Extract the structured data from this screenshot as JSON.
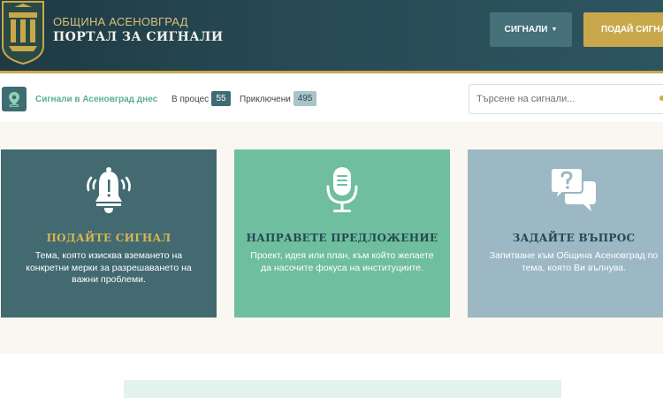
{
  "header": {
    "municipality": "ОБЩИНА АСЕНОВГРАД",
    "portal_title": "ПОРТАЛ ЗА СИГНАЛИ",
    "signals_button": "СИГНАЛИ",
    "submit_button": "ПОДАЙ СИГНАЛ",
    "colors": {
      "bg": "#1f3a44",
      "accent": "#c9a84c",
      "button": "#46707a"
    }
  },
  "status": {
    "title": "Сигнали в Асеновград днес",
    "in_progress_label": "В процес",
    "in_progress_count": "55",
    "completed_label": "Приключени",
    "completed_count": "495",
    "search_placeholder": "Търсене на сигнали..."
  },
  "cards": [
    {
      "icon": "bell-icon",
      "title": "ПОДАЙТЕ СИГНАЛ",
      "description": "Тема, която изисква вземането на конкретни мерки за разрешаването на важни проблеми.",
      "color": "#426a70"
    },
    {
      "icon": "microphone-icon",
      "title": "НАПРАВЕТЕ ПРЕДЛОЖЕНИЕ",
      "description": "Проект, идея или план, към който желаете да насочите фокуса на институциите.",
      "color": "#6fbea0"
    },
    {
      "icon": "question-chat-icon",
      "title": "ЗАДАЙТЕ ВЪПРОС",
      "description": "Запитване към Община Асеновград по тема, която Ви вълнува.",
      "color": "#9bb8c4"
    }
  ]
}
